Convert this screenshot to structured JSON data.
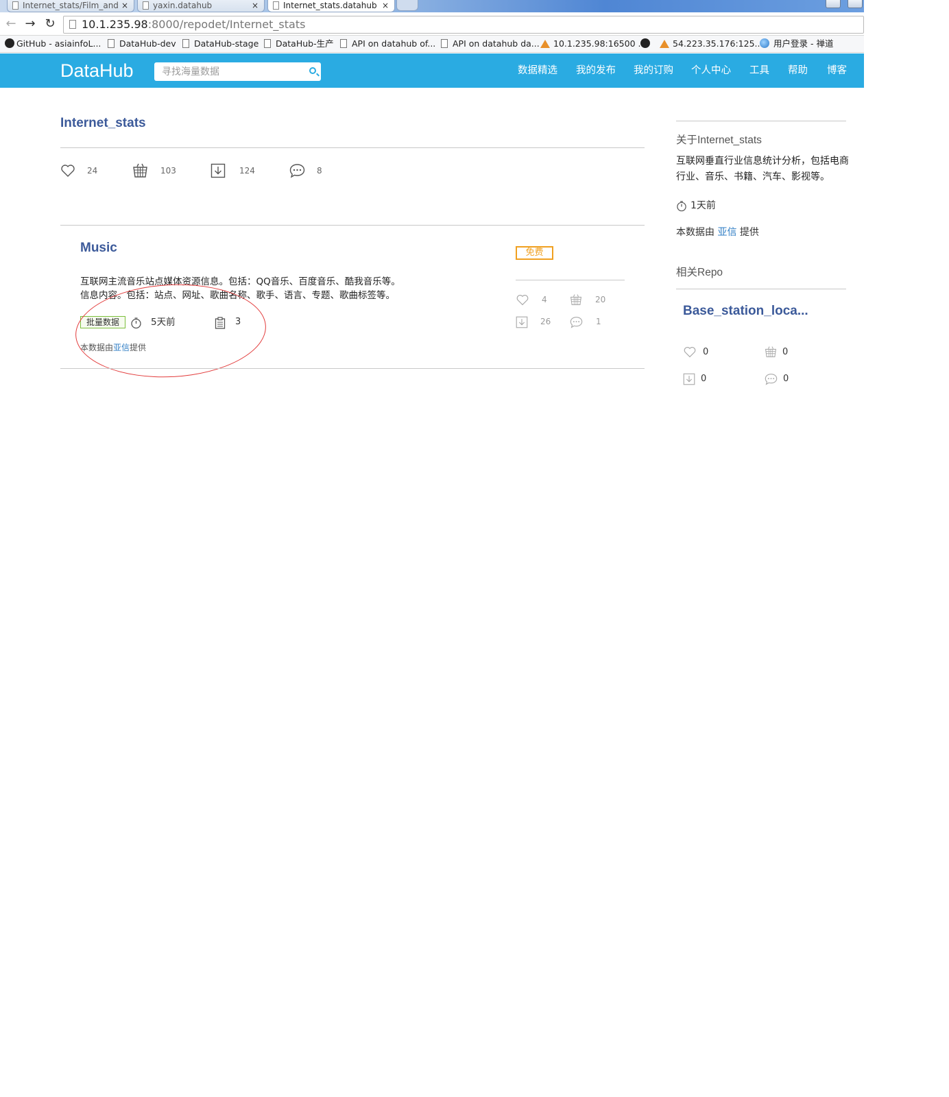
{
  "browser": {
    "tabs": [
      {
        "label": "Internet_stats/Film_and",
        "close": "×"
      },
      {
        "label": "yaxin.datahub",
        "close": "×"
      },
      {
        "label": "Internet_stats.datahub",
        "close": "×"
      }
    ],
    "url_host": "10.1.235.98",
    "url_rest": ":8000/repodet/Internet_stats",
    "bookmarks": [
      {
        "label": "GitHub - asiainfoL...",
        "icon": "github-icon"
      },
      {
        "label": "DataHub-dev",
        "icon": "page-icon"
      },
      {
        "label": "DataHub-stage",
        "icon": "page-icon"
      },
      {
        "label": "DataHub-生产",
        "icon": "page-icon"
      },
      {
        "label": "API on datahub of...",
        "icon": "page-icon"
      },
      {
        "label": "API on datahub da...",
        "icon": "page-icon"
      },
      {
        "label": "10.1.235.98:16500 ...",
        "icon": "phpmyadmin-icon"
      },
      {
        "label": "",
        "icon": "github-icon"
      },
      {
        "label": "54.223.35.176:125...",
        "icon": "phpmyadmin-icon"
      },
      {
        "label": "用户登录 - 禅道",
        "icon": "globe-icon"
      }
    ]
  },
  "header": {
    "logo": "DataHub",
    "search_placeholder": "寻找海量数据",
    "menu": [
      "数据精选",
      "我的发布",
      "我的订购",
      "个人中心",
      "工具",
      "帮助",
      "博客"
    ]
  },
  "repo": {
    "title": "Internet_stats",
    "stats": {
      "likes": "24",
      "subscriptions": "103",
      "downloads": "124",
      "comments": "8"
    }
  },
  "items": [
    {
      "title": "Music",
      "description_line1": "互联网主流音乐站点媒体资源信息。包括：QQ音乐、百度音乐、酷我音乐等。",
      "description_line2": "信息内容。包括：站点、网址、歌曲名称、歌手、语言、专题、歌曲标签等。",
      "type_tag": "批量数据",
      "updated": "5天前",
      "tag_count": "3",
      "provider_prefix": "本数据由",
      "provider_name": "亚信",
      "provider_suffix": "提供",
      "price_badge": "免费",
      "stats": {
        "likes": "4",
        "subscriptions": "20",
        "downloads": "26",
        "comments": "1"
      }
    }
  ],
  "sidebar": {
    "about_title": "关于Internet_stats",
    "about_text": "互联网垂直行业信息统计分析，包括电商行业、音乐、书籍、汽车、影视等。",
    "updated": "1天前",
    "provider_prefix": "本数据由",
    "provider_name": "亚信",
    "provider_suffix": "提供",
    "related_heading": "相关Repo",
    "related": [
      {
        "title": "Base_station_loca...",
        "likes": "0",
        "subscriptions": "0",
        "downloads": "0",
        "comments": "0"
      }
    ]
  },
  "colors": {
    "header_bg": "#2aabe2",
    "title_blue": "#3c5a9a",
    "free_orange": "#f0a020",
    "tag_green": "#7cbf3b",
    "annotation_red": "#e23a3a"
  }
}
